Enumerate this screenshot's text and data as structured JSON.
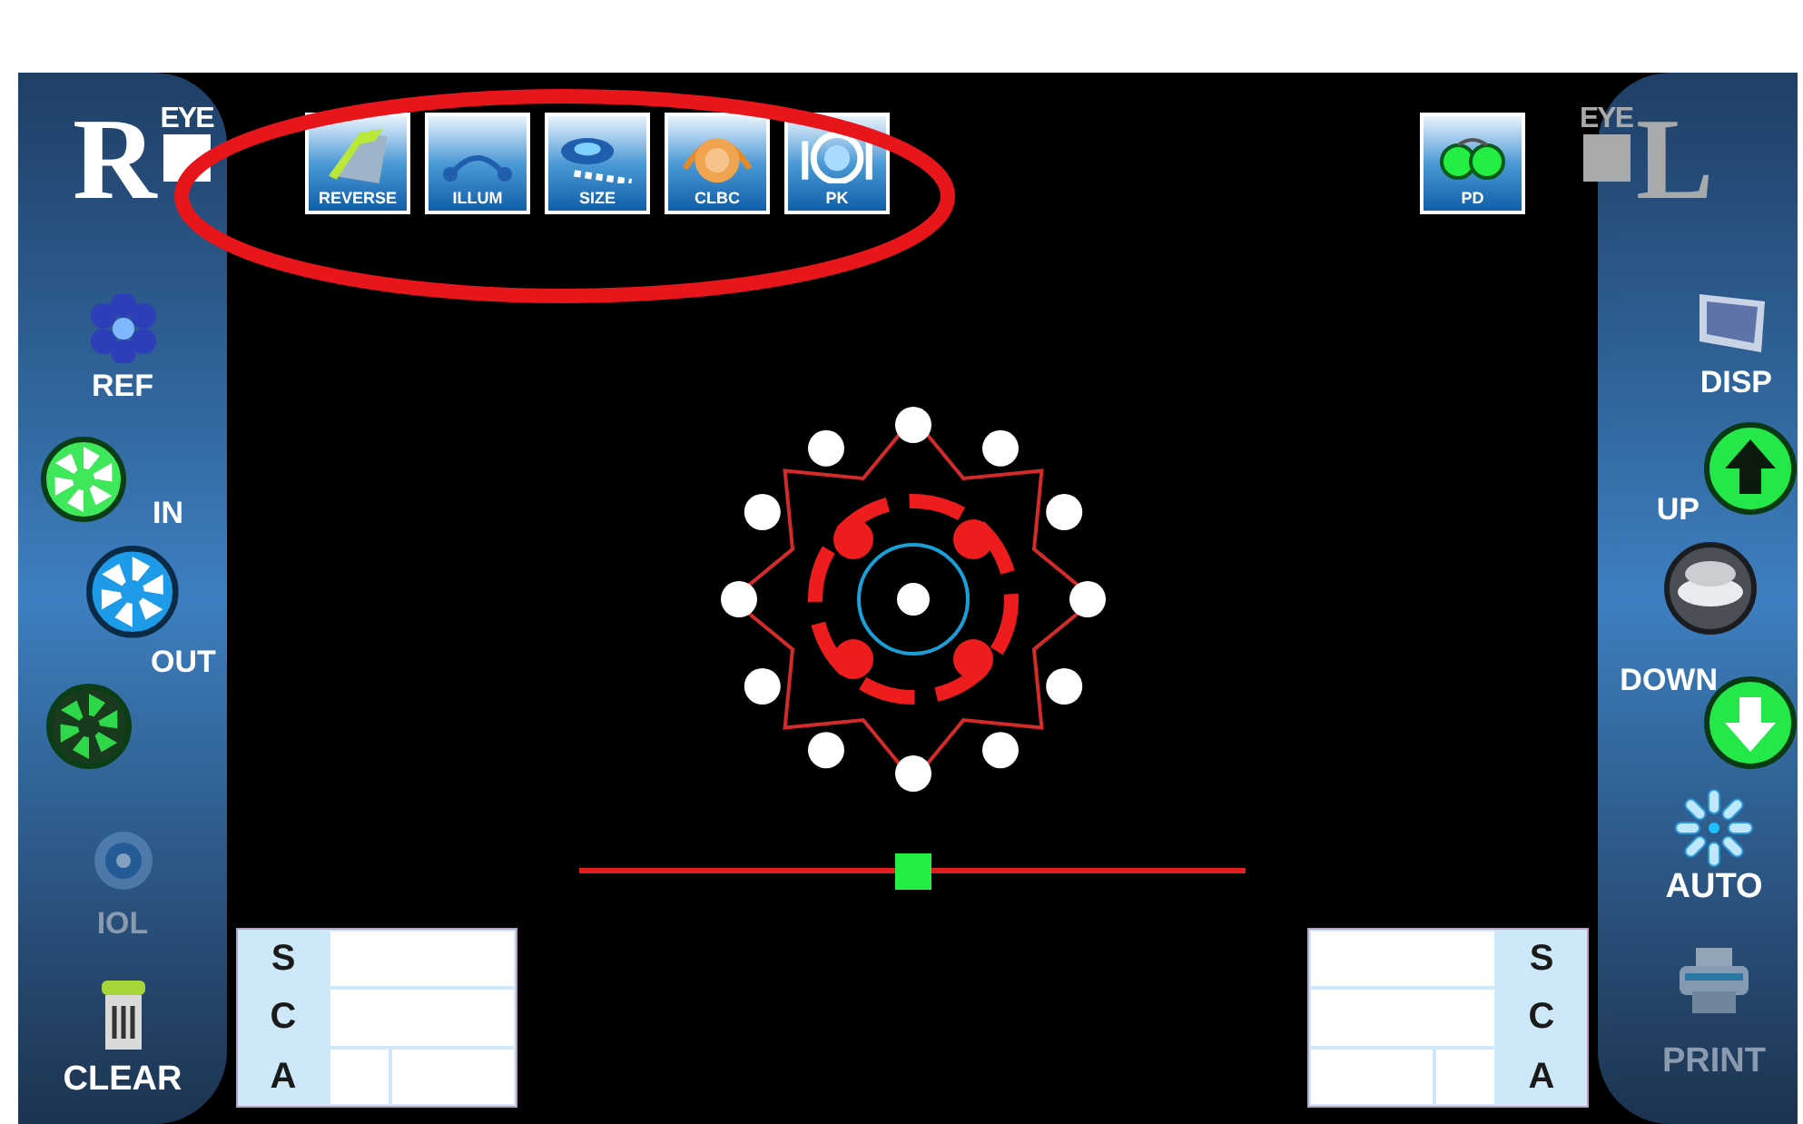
{
  "eyes": [
    {
      "letter": "R",
      "label": "EYE",
      "selected": true
    },
    {
      "letter": "L",
      "label": "EYE",
      "selected": false
    }
  ],
  "toolbar": [
    {
      "label": "REVERSE",
      "kind": "reverse"
    },
    {
      "label": "ILLUM",
      "kind": "illum"
    },
    {
      "label": "SIZE",
      "kind": "size"
    },
    {
      "label": "CLBC",
      "kind": "clbc"
    },
    {
      "label": "PK",
      "kind": "pk"
    }
  ],
  "pd_button": {
    "label": "PD"
  },
  "left_panel": [
    {
      "label": "REF",
      "kind": "ref",
      "disabled": false
    },
    {
      "label": "IN",
      "kind": "in",
      "disabled": false
    },
    {
      "kind": "iris",
      "disabled": false
    },
    {
      "label": "OUT",
      "kind": "out",
      "disabled": false
    },
    {
      "label": "IOL",
      "kind": "iol",
      "disabled": true
    },
    {
      "label": "CLEAR",
      "kind": "clear",
      "disabled": false
    }
  ],
  "right_panel": [
    {
      "label": "DISP",
      "kind": "disp",
      "disabled": false
    },
    {
      "label": "UP",
      "kind": "up",
      "disabled": false
    },
    {
      "label": "DOWN",
      "kind": "down",
      "disabled": false
    },
    {
      "label": "AUTO",
      "kind": "auto",
      "disabled": false
    },
    {
      "label": "PRINT",
      "kind": "print",
      "disabled": true
    }
  ],
  "slider": {
    "level": 0.5
  },
  "left_table": {
    "labels": [
      "S",
      "C",
      "A"
    ]
  },
  "right_table": {
    "labels": [
      "S",
      "C",
      "A"
    ]
  }
}
